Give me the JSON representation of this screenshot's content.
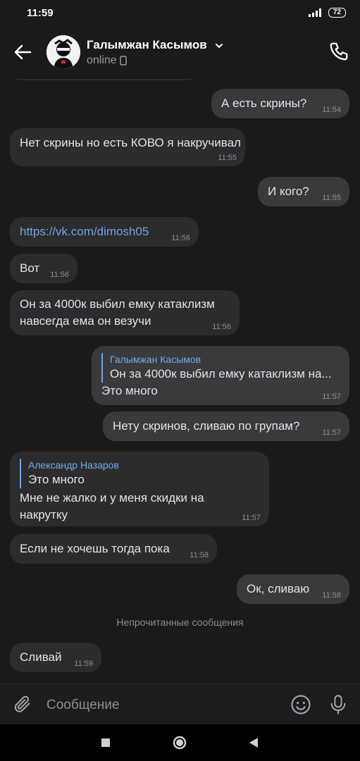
{
  "status_bar": {
    "time": "11:59",
    "battery": "72"
  },
  "header": {
    "contact_name": "Галымжан Касымов",
    "status": "online"
  },
  "messages": [
    {
      "direction": "out",
      "text": "А есть скрины?",
      "time": "11:54"
    },
    {
      "direction": "in",
      "text": "Нет скрины но есть КОВО я накручивал",
      "time": "11:55"
    },
    {
      "direction": "out",
      "text": "И кого?",
      "time": "11:55"
    },
    {
      "direction": "in",
      "text": "https://vk.com/dimosh05",
      "time": "11:56",
      "is_link": true
    },
    {
      "direction": "in",
      "text": "Вот",
      "time": "11:56"
    },
    {
      "direction": "in",
      "lines": [
        "Он за 4000к выбил емку катаклизм",
        "навсегда ема он везучи"
      ],
      "time": "11:56"
    },
    {
      "direction": "out",
      "reply": {
        "author": "Галымжан Касымов",
        "text": "Он за 4000к выбил емку катаклизм на..."
      },
      "text": "Это много",
      "time": "11:57"
    },
    {
      "direction": "out",
      "text": "Нету скринов, сливаю по групам?",
      "time": "11:57"
    },
    {
      "direction": "in",
      "reply": {
        "author": "Александр Назаров",
        "text": "Это много"
      },
      "lines": [
        "Мне не жалко и у меня скидки на",
        "накрутку"
      ],
      "time": "11:57"
    },
    {
      "direction": "in",
      "text": "Если не хочешь тогда пока",
      "time": "11:58"
    },
    {
      "direction": "out",
      "text": "Ок, сливаю",
      "time": "11:58"
    },
    {
      "direction": "in",
      "text": "Сливай",
      "time": "11:59"
    }
  ],
  "unread_separator": "Непрочитанные сообщения",
  "composer": {
    "placeholder": "Сообщение"
  },
  "icons": {
    "back": "arrow-left-icon",
    "chevron": "chevron-down-icon",
    "phone": "phone-icon",
    "mobile": "mobile-device-icon",
    "attach": "paperclip-icon",
    "emoji": "smile-icon",
    "mic": "microphone-icon"
  },
  "colors": {
    "background": "#1a1a1a",
    "bubble_in": "#2c2c2e",
    "bubble_out": "#3a3a3c",
    "link": "#6fa2e4"
  }
}
